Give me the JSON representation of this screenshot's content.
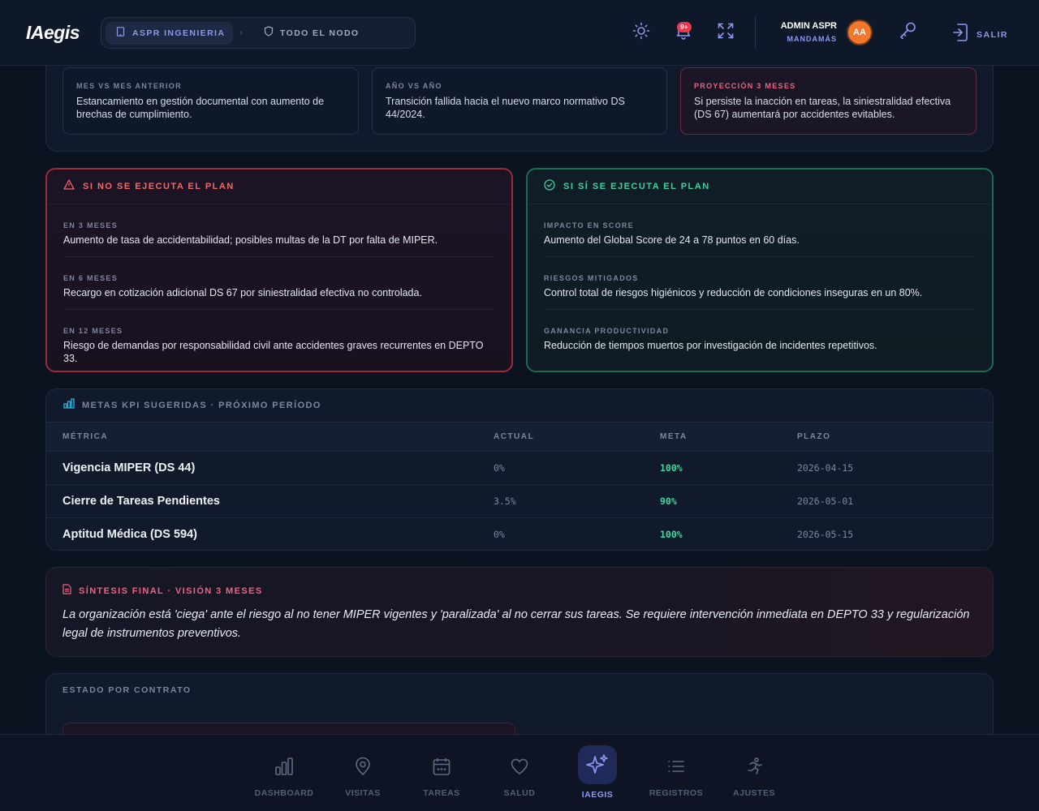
{
  "header": {
    "logo": "IAegis",
    "scope_active": "ASPR INGENIERIA",
    "scope_node": "TODO EL NODO",
    "notifications_badge": "9+",
    "user_name": "ADMIN ASPR",
    "user_role": "MANDAMÁS",
    "avatar_initials": "AA",
    "logout_label": "SALIR"
  },
  "trends": [
    {
      "label": "MES VS MES ANTERIOR",
      "text": "Estancamiento en gestión documental con aumento de brechas de cumplimiento."
    },
    {
      "label": "AÑO VS AÑO",
      "text": "Transición fallida hacia el nuevo marco normativo DS 44/2024."
    },
    {
      "label": "PROYECCIÓN 3 MESES",
      "text": "Si persiste la inacción en tareas, la siniestralidad efectiva (DS 67) aumentará por accidentes evitables."
    }
  ],
  "plan_no": {
    "title": "SI NO SE EJECUTA EL PLAN",
    "items": [
      {
        "label": "EN 3 MESES",
        "text": "Aumento de tasa de accidentabilidad; posibles multas de la DT por falta de MIPER."
      },
      {
        "label": "EN 6 MESES",
        "text": "Recargo en cotización adicional DS 67 por siniestralidad efectiva no controlada."
      },
      {
        "label": "EN 12 MESES",
        "text": "Riesgo de demandas por responsabilidad civil ante accidentes graves recurrentes en DEPTO 33."
      }
    ]
  },
  "plan_yes": {
    "title": "SI SÍ SE EJECUTA EL PLAN",
    "items": [
      {
        "label": "IMPACTO EN SCORE",
        "text": "Aumento del Global Score de 24 a 78 puntos en 60 días."
      },
      {
        "label": "RIESGOS MITIGADOS",
        "text": "Control total de riesgos higiénicos y reducción de condiciones inseguras en un 80%."
      },
      {
        "label": "GANANCIA PRODUCTIVIDAD",
        "text": "Reducción de tiempos muertos por investigación de incidentes repetitivos."
      }
    ]
  },
  "kpi": {
    "title": "METAS KPI SUGERIDAS · PRÓXIMO PERÍODO",
    "columns": [
      "MÉTRICA",
      "ACTUAL",
      "META",
      "PLAZO"
    ],
    "rows": [
      {
        "metric": "Vigencia MIPER (DS 44)",
        "current": "0%",
        "goal": "100%",
        "deadline": "2026-04-15"
      },
      {
        "metric": "Cierre de Tareas Pendientes",
        "current": "3.5%",
        "goal": "90%",
        "deadline": "2026-05-01"
      },
      {
        "metric": "Aptitud Médica (DS 594)",
        "current": "0%",
        "goal": "100%",
        "deadline": "2026-05-15"
      }
    ]
  },
  "synthesis": {
    "title": "SÍNTESIS FINAL · VISIÓN 3 MESES",
    "text": "La organización está 'ciega' ante el riesgo al no tener MIPER vigentes y 'paralizada' al no cerrar sus tareas. Se requiere intervención inmediata en DEPTO 33 y regularización legal de instrumentos preventivos."
  },
  "contract": {
    "title": "ESTADO POR CONTRATO"
  },
  "nav": {
    "items": [
      {
        "label": "DASHBOARD",
        "icon": "bar-chart-icon"
      },
      {
        "label": "VISITAS",
        "icon": "map-pin-icon"
      },
      {
        "label": "TAREAS",
        "icon": "calendar-icon"
      },
      {
        "label": "SALUD",
        "icon": "heart-icon"
      },
      {
        "label": "IAEGIS",
        "icon": "sparkles-icon"
      },
      {
        "label": "REGISTROS",
        "icon": "list-icon"
      },
      {
        "label": "AJUSTES",
        "icon": "runner-icon"
      }
    ],
    "active": "IAEGIS"
  },
  "colors": {
    "accent": "#8c99ee",
    "danger": "#f26a6a",
    "success": "#3fd0a0",
    "pink": "#f06282",
    "avatar": "#f2772a",
    "background": "#0b1220"
  }
}
